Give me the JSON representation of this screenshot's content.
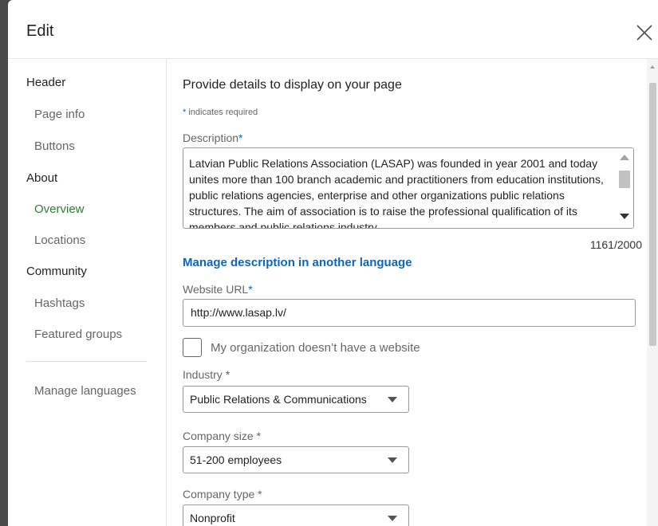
{
  "modal": {
    "title": "Edit"
  },
  "sidebar": {
    "sections": [
      {
        "label": "Header"
      },
      {
        "label": "About"
      },
      {
        "label": "Community"
      }
    ],
    "items": {
      "page_info": "Page info",
      "buttons": "Buttons",
      "overview": "Overview",
      "locations": "Locations",
      "hashtags": "Hashtags",
      "featured_groups": "Featured groups",
      "manage_languages": "Manage languages"
    },
    "active_color": "#2e7d32"
  },
  "form": {
    "intro": "Provide details to display on your page",
    "required_note": "indicates required",
    "required_star": "*",
    "description": {
      "label": "Description",
      "value": "Latvian Public Relations Association (LASAP) was founded in year 2001 and today unites more than 100 branch academic and practitioners from education institutions, public relations agencies, enterprise and other organizations public relations structures. The aim of association is to raise the professional qualification of its members and public relations industry",
      "counter": "1161/2000"
    },
    "manage_language_link": "Manage description in another language",
    "website": {
      "label": "Website URL",
      "value": "http://www.lasap.lv/"
    },
    "no_website_checkbox": {
      "label": "My organization doesn’t have a website",
      "checked": false
    },
    "industry": {
      "label": "Industry *",
      "value": "Public Relations & Communications"
    },
    "company_size": {
      "label": "Company size *",
      "value": "51-200 employees"
    },
    "company_type": {
      "label": "Company type *",
      "value": "Nonprofit"
    }
  },
  "colors": {
    "accent": "#0a66c2",
    "active_nav": "#2e7d32",
    "backdrop": "#4a4a4a"
  }
}
